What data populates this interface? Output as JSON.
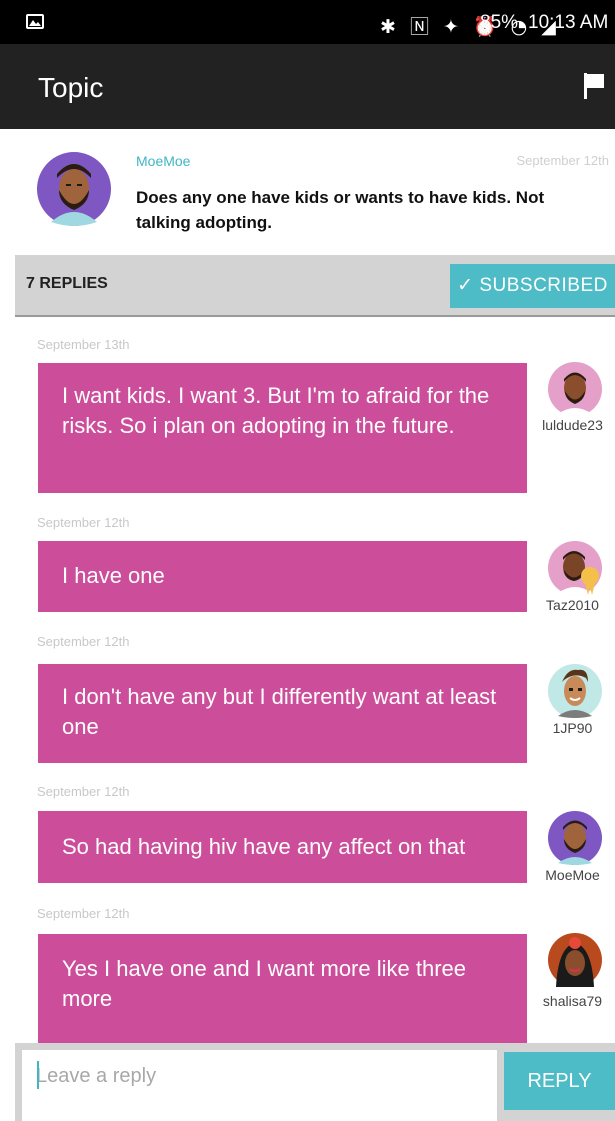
{
  "status_bar": {
    "icons": "✱ 🄽 ✦ ⏰ ◔ ◢",
    "battery": "85%",
    "time": "10:13 AM"
  },
  "app_bar": {
    "title": "Topic",
    "flag_icon": "flag-icon"
  },
  "topic": {
    "author": "MoeMoe",
    "date": "September 12th",
    "text": "Does any one have kids or wants to have kids. Not talking adopting."
  },
  "replies_bar": {
    "count_label": "7 REPLIES",
    "subscribe_label": "✓ SUBSCRIBED"
  },
  "messages": [
    {
      "date": "September 13th",
      "text": "I want kids. I want 3. But I'm to afraid for the risks. So i plan on adopting in the future.",
      "user": "luldude23"
    },
    {
      "date": "September 12th",
      "text": "I have one",
      "user": "Taz2010"
    },
    {
      "date": "September 12th",
      "text": "I don't have any but I differently want at least one",
      "user": "1JP90"
    },
    {
      "date": "September 12th",
      "text": "So had having hiv have any affect on that",
      "user": "MoeMoe"
    },
    {
      "date": "September 12th",
      "text": "Yes I have one and I want more like three more",
      "user": "shalisa79"
    }
  ],
  "reply": {
    "placeholder": "Leave a reply",
    "button_label": "REPLY"
  },
  "colors": {
    "accent": "#4dbcc6",
    "bubble": "#cc4e9b",
    "app_bar": "#222222",
    "author": "#3fb6c4"
  }
}
